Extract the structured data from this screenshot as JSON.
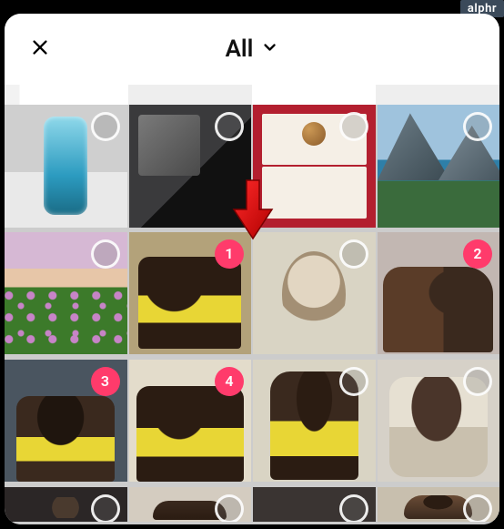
{
  "watermark": "alphr",
  "header": {
    "close_label": "Close",
    "title": "All"
  },
  "selection_color": "#ff3b6b",
  "grid": {
    "columns": 4,
    "items": [
      {
        "desc": "blue-can",
        "selected": false,
        "order": null
      },
      {
        "desc": "laptop-trackpad",
        "selected": false,
        "order": null
      },
      {
        "desc": "bird-and-cow-collage",
        "selected": false,
        "order": null
      },
      {
        "desc": "mountain-lake",
        "selected": false,
        "order": null
      },
      {
        "desc": "flower-field-sunset",
        "selected": false,
        "order": null
      },
      {
        "desc": "dachshund-yellow-1",
        "selected": true,
        "order": "1"
      },
      {
        "desc": "fluffy-dog",
        "selected": false,
        "order": null
      },
      {
        "desc": "dachshund-closeup-1",
        "selected": true,
        "order": "2"
      },
      {
        "desc": "dachshund-yellow-2",
        "selected": true,
        "order": "3"
      },
      {
        "desc": "dachshund-yellow-3",
        "selected": true,
        "order": "4"
      },
      {
        "desc": "dachshund-yellow-4",
        "selected": false,
        "order": null
      },
      {
        "desc": "brown-white-dog",
        "selected": false,
        "order": null
      },
      {
        "desc": "dark-photo-1",
        "selected": false,
        "order": null
      },
      {
        "desc": "dog-on-tile",
        "selected": false,
        "order": null
      },
      {
        "desc": "dark-photo-2",
        "selected": false,
        "order": null
      },
      {
        "desc": "puppy-looking-up",
        "selected": false,
        "order": null
      }
    ]
  },
  "annotation": {
    "type": "red-arrow",
    "points_to_item": 5
  }
}
